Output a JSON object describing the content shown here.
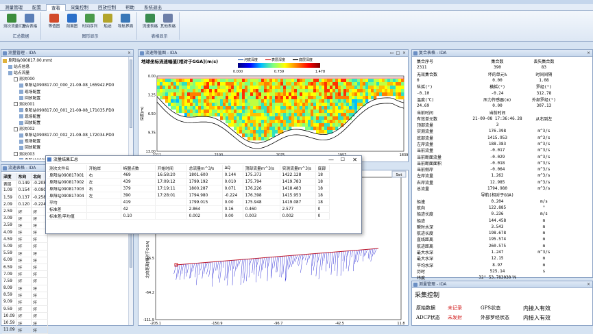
{
  "window": {
    "title_left": "VLR",
    "title_extra": "…"
  },
  "menu": [
    {
      "label": "测量管理",
      "active": false
    },
    {
      "label": "配置",
      "active": false
    },
    {
      "label": "查看",
      "active": true
    },
    {
      "label": "采集控制",
      "active": false
    },
    {
      "label": "回放控制",
      "active": false
    },
    {
      "label": "帮助",
      "active": false
    },
    {
      "label": "系统退出",
      "active": false
    }
  ],
  "ribbon": {
    "groups": [
      {
        "label": "汇总数据",
        "buttons": [
          {
            "label": "测次流量汇总",
            "icon": "summary-icon",
            "color": "#3c8d3c"
          },
          {
            "label": "复合表格",
            "icon": "table-icon",
            "color": "#5b7fb7"
          }
        ]
      },
      {
        "label": "图形显示",
        "buttons": [
          {
            "label": "等值图",
            "icon": "contour-icon",
            "color": "#d24a2a"
          },
          {
            "label": "剖面图",
            "icon": "profile-icon",
            "color": "#2a6fc9"
          },
          {
            "label": "时间序列",
            "icon": "timeseries-icon",
            "color": "#4a9a4a"
          },
          {
            "label": "船迹",
            "icon": "track-icon",
            "color": "#b3a52b"
          },
          {
            "label": "导航界面",
            "icon": "navigation-icon",
            "color": "#3a78b8"
          }
        ]
      },
      {
        "label": "表格显示",
        "buttons": [
          {
            "label": "流速表格",
            "icon": "velocity-table-icon",
            "color": "#3a8c4f"
          },
          {
            "label": "其他表格",
            "icon": "other-table-icon",
            "color": "#6d7fa8"
          }
        ]
      }
    ]
  },
  "project_panel": {
    "title": "测量管理 - IDA",
    "nodes": [
      {
        "label": "阜阳站090817.00.mmt",
        "indent": 0,
        "type": "root"
      },
      {
        "label": "站点信息",
        "indent": 1,
        "type": "item"
      },
      {
        "label": "站点流量",
        "indent": 1,
        "type": "folder"
      },
      {
        "label": "测次000",
        "indent": 2,
        "type": "check"
      },
      {
        "label": "阜阳站090817.00_000_21-09-08_165942.PD0",
        "indent": 3,
        "type": "file"
      },
      {
        "label": "现场配置",
        "indent": 3,
        "type": "item"
      },
      {
        "label": "回放配置",
        "indent": 3,
        "type": "item"
      },
      {
        "label": "测次001",
        "indent": 2,
        "type": "check"
      },
      {
        "label": "阜阳站090817.00_001_21-09-08_171035.PD0",
        "indent": 3,
        "type": "file"
      },
      {
        "label": "现场配置",
        "indent": 3,
        "type": "item"
      },
      {
        "label": "回放配置",
        "indent": 3,
        "type": "item"
      },
      {
        "label": "测次002",
        "indent": 2,
        "type": "check"
      },
      {
        "label": "阜阳站090817.00_002_21-09-08_172034.PD0",
        "indent": 3,
        "type": "file"
      },
      {
        "label": "现场配置",
        "indent": 3,
        "type": "item"
      },
      {
        "label": "回放配置",
        "indent": 3,
        "type": "item"
      },
      {
        "label": "测次003",
        "indent": 2,
        "type": "check"
      },
      {
        "label": "阜阳站090817.00_003_21-09-08_172922.PD0",
        "indent": 3,
        "type": "file"
      }
    ]
  },
  "velocity_table": {
    "title": "流速表格 - IDA",
    "headers": [
      "深度",
      "东向",
      "北向"
    ],
    "rows": [
      [
        "表层",
        "0.149",
        "-0.208"
      ],
      [
        "1.09",
        "0.154",
        "-0.090"
      ],
      [
        "1.59",
        "0.137",
        "-0.258"
      ],
      [
        "2.09",
        "0.120",
        "-0.224"
      ],
      [
        "2.59",
        "坏",
        "坏"
      ],
      [
        "3.09",
        "坏",
        "坏"
      ],
      [
        "3.59",
        "坏",
        "坏"
      ],
      [
        "4.09",
        "坏",
        "坏"
      ],
      [
        "4.59",
        "坏",
        "坏"
      ],
      [
        "5.09",
        "坏",
        "坏"
      ],
      [
        "5.59",
        "坏",
        "坏"
      ],
      [
        "6.09",
        "坏",
        "坏"
      ],
      [
        "6.59",
        "坏",
        "坏"
      ],
      [
        "7.09",
        "坏",
        "坏"
      ],
      [
        "7.59",
        "坏",
        "坏"
      ],
      [
        "8.09",
        "坏",
        "坏"
      ],
      [
        "8.59",
        "坏",
        "坏"
      ],
      [
        "9.09",
        "坏",
        "坏"
      ],
      [
        "9.59",
        "坏",
        "坏"
      ],
      [
        "10.09",
        "坏",
        "坏"
      ],
      [
        "10.59",
        "坏",
        "坏"
      ],
      [
        "11.09",
        "坏",
        "坏"
      ]
    ]
  },
  "contour_panel": {
    "title": "流速等值图 - IDA",
    "chart_title": "地球坐标流速幅值[相对于GGA](m/s)",
    "legend": [
      "河底深度",
      "表层深度",
      "底层深度"
    ],
    "colorbar_ticks": [
      "0.000",
      "0.739",
      "1.478"
    ],
    "ylabel": "深度(m)",
    "yticks": [
      "0.00",
      "3.25",
      "6.50",
      "9.75",
      "13.00"
    ],
    "xticks": [
      "2211",
      "2193",
      "2075",
      "1957",
      "1839"
    ]
  },
  "summary_dialog": {
    "title": "流量结果汇总",
    "headers": [
      "测次文件名",
      "开始岸",
      "峙盟点数",
      "开始时间",
      "总流量m^3/s",
      "ΔQ",
      "顶部流量m^3/s",
      "实测流量m^3/s",
      "底部"
    ],
    "rows": [
      [
        "阜阳站090817001",
        "右",
        "469",
        "16:58:20",
        "1801.600",
        "0.144",
        "175.373",
        "1422.128",
        "18"
      ],
      [
        "阜阳站090817002",
        "左",
        "439",
        "17:09:12",
        "1799.192",
        "0.010",
        "175.794",
        "1419.783",
        "18"
      ],
      [
        "阜阳站090817003",
        "右",
        "379",
        "17:19:11",
        "1800.287",
        "0.071",
        "176.226",
        "1418.483",
        "18"
      ],
      [
        "阜阳站090817004",
        "左",
        "390",
        "17:28:01",
        "1794.980",
        "-0.224",
        "176.398",
        "1415.953",
        "18"
      ],
      [
        "平均",
        "",
        "419",
        "",
        "1799.015",
        "0.00",
        "175.948",
        "1419.087",
        "18"
      ],
      [
        "标准差",
        "",
        "42",
        "",
        "2.864",
        "0.16",
        "0.460",
        "2.577",
        "0"
      ],
      [
        "标准差/平均值",
        "",
        "0.10",
        "",
        "0.002",
        "0.00",
        "0.003",
        "0.002",
        "0"
      ]
    ]
  },
  "track_panel": {
    "title": "流速剖面",
    "set_label": "Set",
    "ylabel": "北向距离[相对于GGA]",
    "yticks": [
      "-16.5",
      "-64.2",
      "-111.9"
    ],
    "xticks": [
      "-205.1",
      "-150.9",
      "-96.7",
      "-42.5",
      "11.8"
    ]
  },
  "composite_panel": {
    "title": "复合表格 - IDA",
    "rows": [
      [
        "集合序号",
        "集合数",
        "丢失集合数"
      ],
      [
        "2311",
        "390",
        "83"
      ],
      [
        "无效集合数",
        "坏的单元%",
        "时间间隔"
      ],
      [
        "0",
        "0.00",
        "1.08"
      ],
      [
        "纵摇(°)",
        "横摇(°)",
        "罗经(°)"
      ],
      [
        "-0.10",
        "-0.24",
        "312.78"
      ],
      [
        "温度(℃)",
        "压力传感器(m)",
        "外部罗经(°)"
      ],
      [
        "24.69",
        "0.00",
        "307.13"
      ],
      [
        "当前时间",
        "当前时间",
        ""
      ],
      [
        "有效单元数",
        "21-09-08 17:36:46.28",
        "从右到左"
      ],
      [
        "顶部流量",
        "3",
        ""
      ],
      [
        "实测流量",
        "176.398",
        "m^3/s"
      ],
      [
        "底部流量",
        "1415.953",
        "m^3/s"
      ],
      [
        "左岸流量",
        "188.383",
        "m^3/s"
      ],
      [
        "当前流量",
        "-0.017",
        "m^3/s"
      ],
      [
        "当前断面流量",
        "-0.029",
        "m^3/s"
      ],
      [
        "当前断面面积",
        "-0.018",
        "m^3/s"
      ],
      [
        "当前侧岸",
        "-0.064",
        "m^3/s"
      ],
      [
        "左岸流量",
        "1.262",
        "m^3/s"
      ],
      [
        "右岸流量",
        "12.985",
        "m^3/s"
      ],
      [
        "总流量",
        "1794.980",
        "m^3/s"
      ],
      [
        "",
        "导航(相对于GGA)",
        ""
      ],
      [
        "船速",
        "0.204",
        "m/s"
      ],
      [
        "航向",
        "122.885",
        "°"
      ],
      [
        "船迹长度",
        "0.236",
        "m/s"
      ],
      [
        "船迹",
        "144.458",
        "m"
      ],
      [
        "瞬时水深",
        "3.543",
        "m"
      ],
      [
        "航迹长度",
        "198.678",
        "m"
      ],
      [
        "直线距离",
        "195.574",
        "m"
      ],
      [
        "航迹距离",
        "260.575",
        "m"
      ],
      [
        "最大水深",
        "1.247",
        "m^3/s"
      ],
      [
        "最大水深",
        "12.15",
        "m"
      ],
      [
        "平均水深",
        "8.97",
        "m"
      ],
      [
        "历时",
        "525.14",
        "s"
      ],
      [
        "纬度",
        "32° 53.783030'N",
        ""
      ],
      [
        "经度",
        "115° 50.305920'E",
        ""
      ]
    ]
  },
  "acq_panel": {
    "title": "测量管理 - IDA",
    "heading": "采集控制",
    "status": [
      {
        "label": "原始数据",
        "value": "未记录",
        "label2": "GPS状态",
        "value2": "内接入有效"
      },
      {
        "label": "ADCP状态",
        "value": "未发射",
        "label2": "外部罗经状态",
        "value2": "内接入有效"
      }
    ]
  },
  "colors": {
    "accent": "#3d6cb3",
    "status_red": "#d21f1f",
    "bank_line": "#000000",
    "track_line": "#2c2cd6",
    "start_marker": "#c8141e"
  }
}
